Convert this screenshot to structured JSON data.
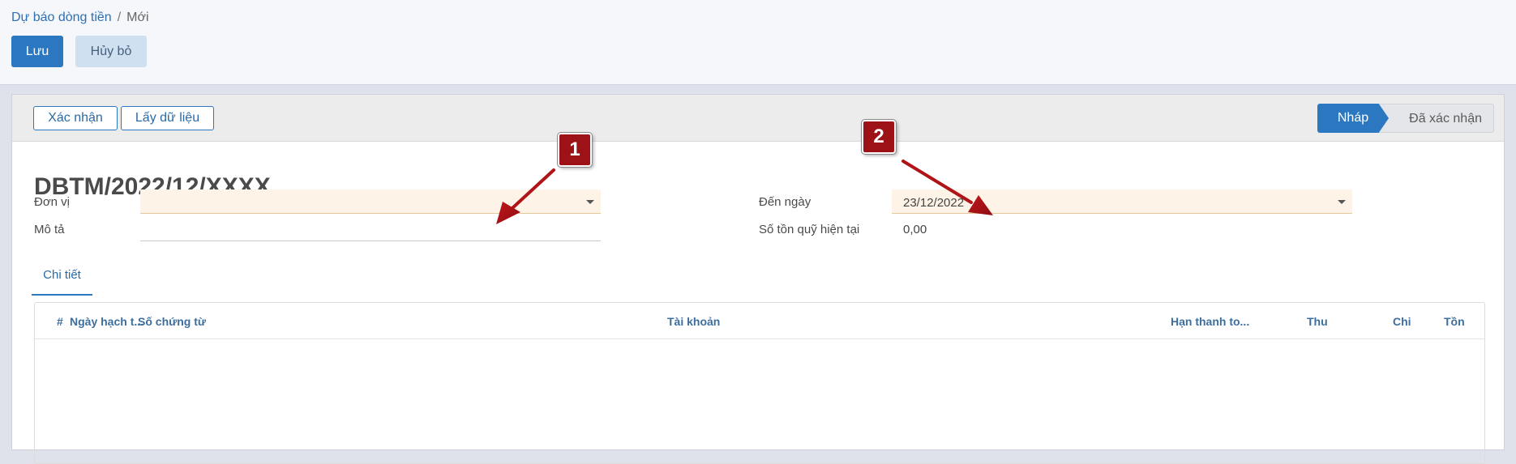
{
  "breadcrumb": {
    "parent": "Dự báo dòng tiền",
    "separator": "/",
    "current": "Mới"
  },
  "toolbar": {
    "save_label": "Lưu",
    "discard_label": "Hủy bỏ"
  },
  "statusbar": {
    "confirm_label": "Xác nhận",
    "fetch_label": "Lấy dữ liệu",
    "stages": {
      "draft": "Nháp",
      "confirmed": "Đã xác nhận"
    },
    "active_stage": "draft"
  },
  "record": {
    "title": "DBTM/2022/12/XXXX",
    "fields": {
      "unit_label": "Đơn vị",
      "unit_value": "",
      "description_label": "Mô tả",
      "description_value": "",
      "to_date_label": "Đến ngày",
      "to_date_value": "23/12/2022",
      "balance_label": "Số tồn quỹ hiện tại",
      "balance_value": "0,00"
    }
  },
  "tabs": [
    {
      "label": "Chi tiết",
      "active": true
    }
  ],
  "table": {
    "columns": [
      "#",
      "Ngày hạch t...",
      "Số chứng từ",
      "Tài khoản",
      "Hạn thanh to...",
      "Thu",
      "Chi",
      "Tồn"
    ],
    "rows": []
  },
  "annotations": {
    "badge_1": "1",
    "badge_2": "2"
  },
  "colors": {
    "primary": "#2b78c0",
    "badge": "#9c1216",
    "required_field": "#fdf3e6"
  }
}
